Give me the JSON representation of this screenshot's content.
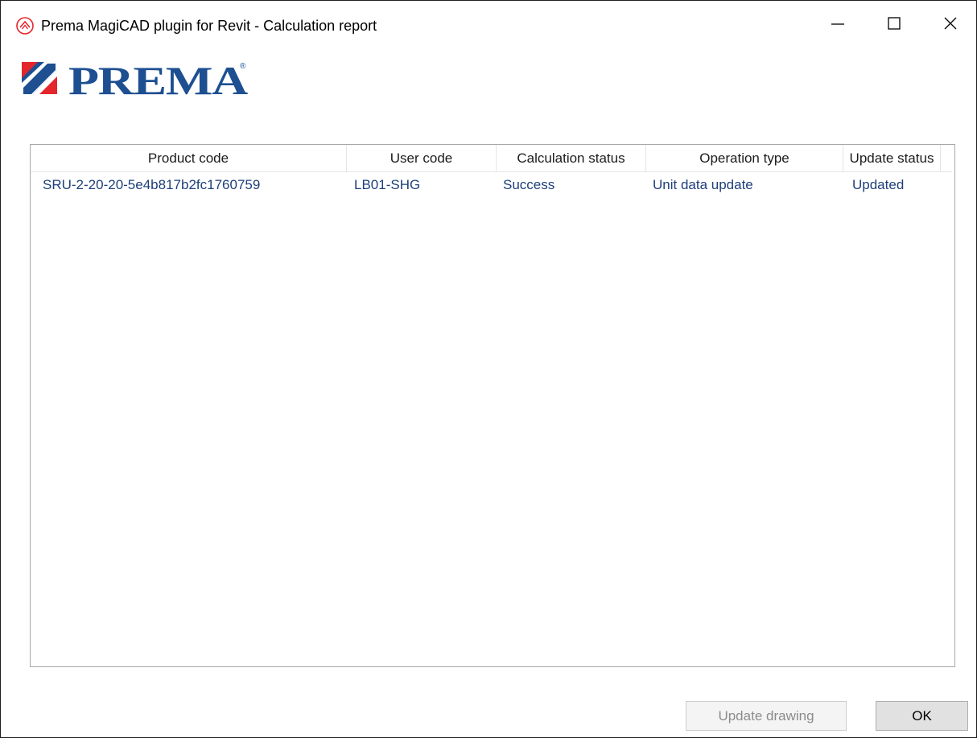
{
  "window": {
    "title": "Prema MagiCAD plugin for Revit - Calculation report",
    "controls": {
      "minimize_icon": "minimize-icon",
      "maximize_icon": "maximize-icon",
      "close_icon": "close-icon"
    }
  },
  "logo": {
    "text": "PREMA",
    "registered_mark": "®",
    "colors": {
      "blue": "#1d4f91",
      "red": "#e4262c"
    }
  },
  "table": {
    "columns": [
      "Product code",
      "User code",
      "Calculation status",
      "Operation type",
      "Update status"
    ],
    "rows": [
      {
        "product_code": "SRU-2-20-20-5e4b817b2fc1760759",
        "user_code": "LB01-SHG",
        "calculation_status": "Success",
        "operation_type": "Unit data update",
        "update_status": "Updated"
      }
    ]
  },
  "buttons": {
    "update_drawing": "Update drawing",
    "ok": "OK"
  },
  "colors": {
    "row_text": "#1e3f7a",
    "disabled_text": "#8c8c8c"
  }
}
